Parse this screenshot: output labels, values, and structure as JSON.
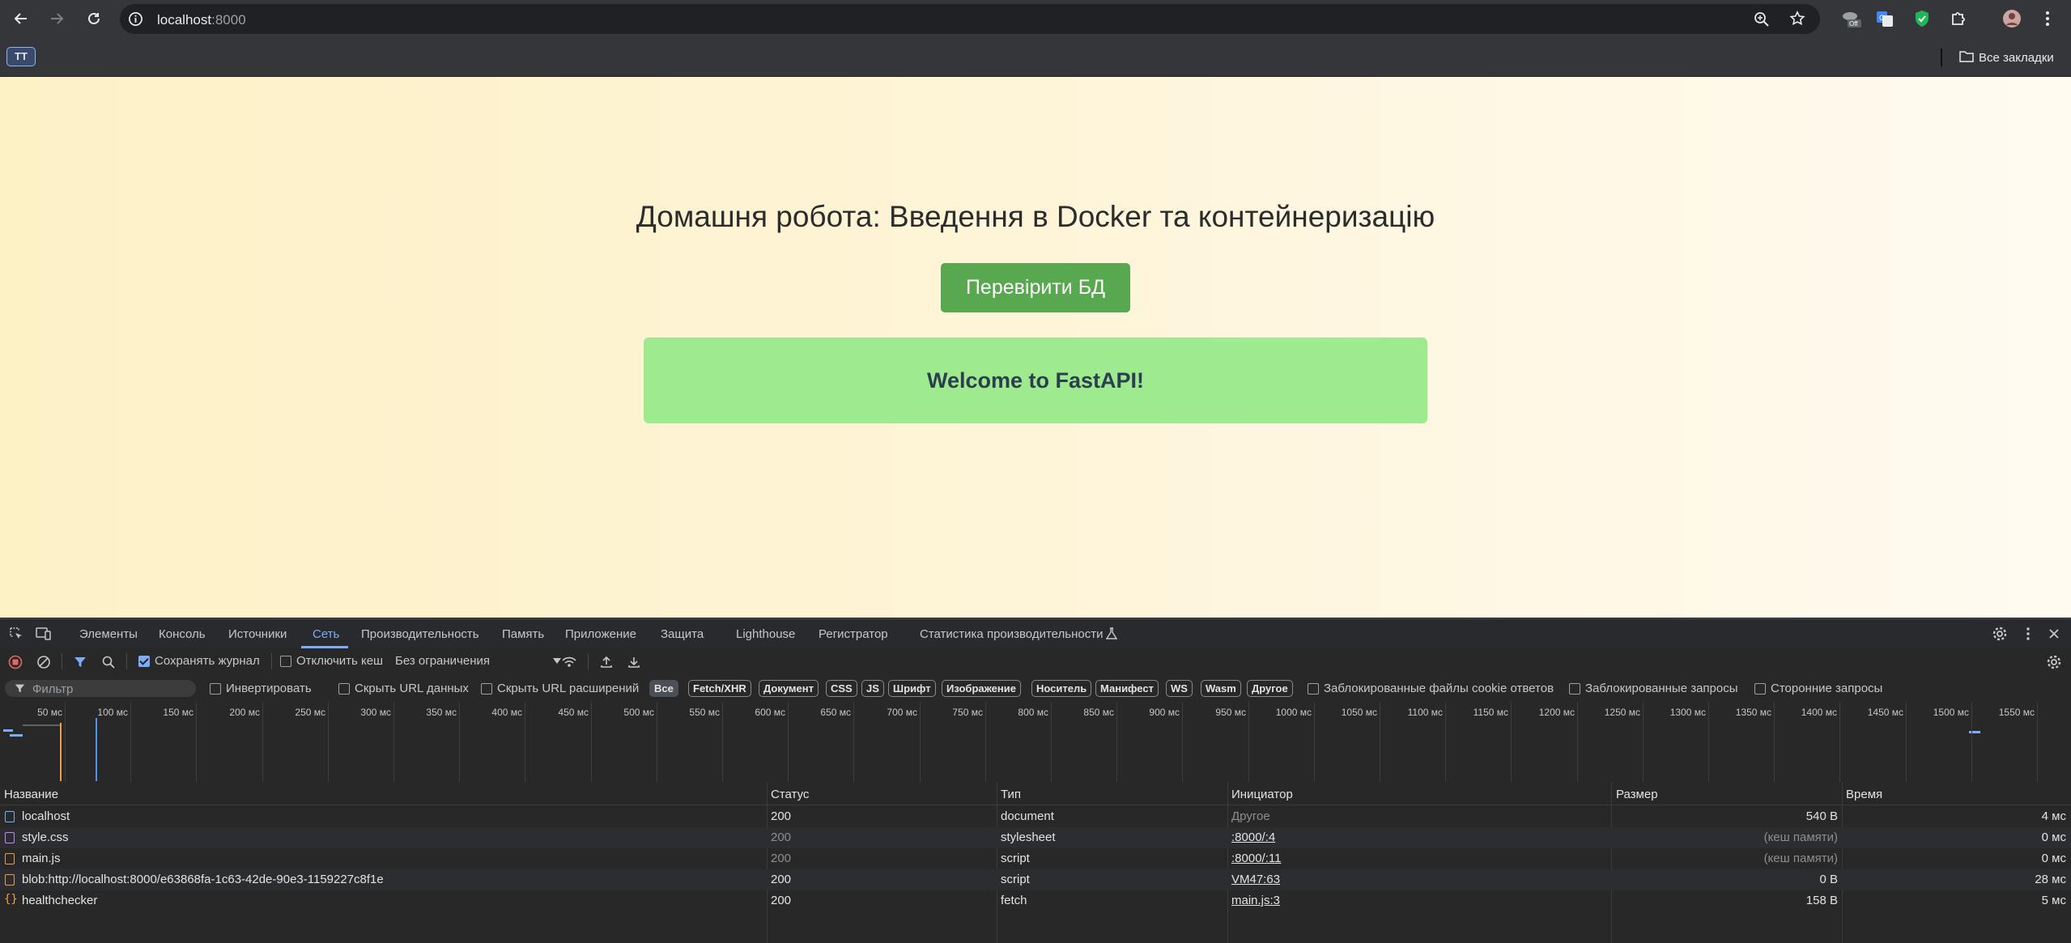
{
  "browser": {
    "url_host": "localhost",
    "url_port": ":8000",
    "bookmark_tag": "TT",
    "all_bookmarks": "Все закладки",
    "icons": [
      "back-arrow-icon",
      "forward-arrow-icon",
      "reload-icon",
      "info-icon",
      "zoom-icon",
      "star-icon",
      "extension-off-icon",
      "translate-icon",
      "shield-icon",
      "puzzle-icon",
      "avatar",
      "kebab-menu-icon",
      "folder-icon"
    ]
  },
  "page": {
    "title": "Домашня робота: Введення в Docker та контейнеризацію",
    "check_button": "Перевірити БД",
    "result_message": "Welcome to FastAPI!",
    "colors": {
      "button": "#57a84f",
      "result_bg": "#9eea8e"
    }
  },
  "devtools": {
    "tabs": [
      "Элементы",
      "Консоль",
      "Источники",
      "Сеть",
      "Производительность",
      "Память",
      "Приложение",
      "Защита",
      "Lighthouse",
      "Регистратор",
      "Статистика производительности"
    ],
    "active_tab": "Сеть",
    "toolbar": {
      "preserve_log": "Сохранять журнал",
      "disable_cache": "Отключить кеш",
      "throttling": "Без ограничения"
    },
    "filter": {
      "placeholder": "Фильтр",
      "invert": "Инвертировать",
      "hide_data_urls": "Скрыть URL данных",
      "hide_ext_urls": "Скрыть URL расширений",
      "types": [
        "Все",
        "Fetch/XHR",
        "Документ",
        "CSS",
        "JS",
        "Шрифт",
        "Изображение",
        "Носитель",
        "Манифест",
        "WS",
        "Wasm",
        "Другое"
      ],
      "blocked_cookies": "Заблокированные файлы cookie ответов",
      "blocked_requests": "Заблокированные запросы",
      "third_party": "Сторонние запросы"
    },
    "timeline_ticks": [
      "50 мс",
      "100 мс",
      "150 мс",
      "200 мс",
      "250 мс",
      "300 мс",
      "350 мс",
      "400 мс",
      "450 мс",
      "500 мс",
      "550 мс",
      "600 мс",
      "650 мс",
      "700 мс",
      "750 мс",
      "800 мс",
      "850 мс",
      "900 мс",
      "950 мс",
      "1000 мс",
      "1050 мс",
      "1100 мс",
      "1150 мс",
      "1200 мс",
      "1250 мс",
      "1300 мс",
      "1350 мс",
      "1400 мс",
      "1450 мс",
      "1500 мс",
      "1550 мс"
    ],
    "columns": [
      "Название",
      "Статус",
      "Тип",
      "Инициатор",
      "Размер",
      "Время"
    ],
    "rows": [
      {
        "name": "localhost",
        "status": "200",
        "type": "document",
        "initiator": "Другое",
        "size": "540 B",
        "time": "4 мс"
      },
      {
        "name": "style.css",
        "status": "200",
        "type": "stylesheet",
        "initiator": ":8000/:4",
        "size": "(кеш памяти)",
        "time": "0 мс"
      },
      {
        "name": "main.js",
        "status": "200",
        "type": "script",
        "initiator": ":8000/:11",
        "size": "(кеш памяти)",
        "time": "0 мс"
      },
      {
        "name": "blob:http://localhost:8000/e63868fa-1c63-42de-90e3-1159227c8f1e",
        "status": "200",
        "type": "script",
        "initiator": "VM47:63",
        "size": "0 B",
        "time": "28 мс"
      },
      {
        "name": "healthchecker",
        "status": "200",
        "type": "fetch",
        "initiator": "main.js:3",
        "size": "158 B",
        "time": "5 мс"
      }
    ]
  }
}
